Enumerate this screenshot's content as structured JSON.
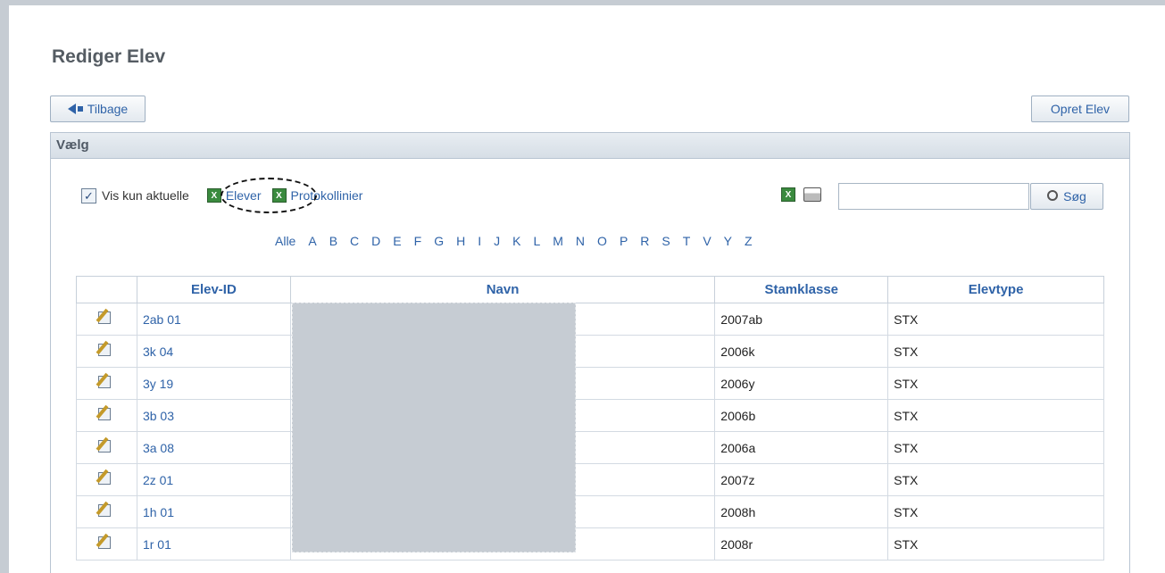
{
  "page": {
    "title": "Rediger Elev"
  },
  "buttons": {
    "back": "Tilbage",
    "create": "Opret Elev",
    "search": "Søg"
  },
  "panel": {
    "header": "Vælg"
  },
  "toolbar": {
    "checkbox_label": "Vis kun aktuelle",
    "checkbox_checked": true,
    "link_elever": "Elever",
    "link_protokollinier": "Protokollinier",
    "search_value": ""
  },
  "letters": [
    "Alle",
    "A",
    "B",
    "C",
    "D",
    "E",
    "F",
    "G",
    "H",
    "I",
    "J",
    "K",
    "L",
    "M",
    "N",
    "O",
    "P",
    "R",
    "S",
    "T",
    "V",
    "Y",
    "Z"
  ],
  "table": {
    "headers": {
      "id": "Elev-ID",
      "name": "Navn",
      "class": "Stamklasse",
      "type": "Elevtype"
    },
    "rows": [
      {
        "id": "2ab 01",
        "class": "2007ab",
        "type": "STX"
      },
      {
        "id": "3k 04",
        "class": "2006k",
        "type": "STX"
      },
      {
        "id": "3y 19",
        "class": "2006y",
        "type": "STX"
      },
      {
        "id": "3b 03",
        "class": "2006b",
        "type": "STX"
      },
      {
        "id": "3a 08",
        "class": "2006a",
        "type": "STX"
      },
      {
        "id": "2z 01",
        "class": "2007z",
        "type": "STX"
      },
      {
        "id": "1h 01",
        "class": "2008h",
        "type": "STX"
      },
      {
        "id": "1r 01",
        "class": "2008r",
        "type": "STX"
      }
    ]
  }
}
